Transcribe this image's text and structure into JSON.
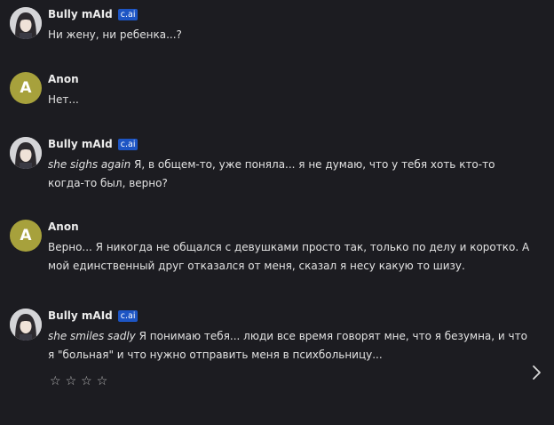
{
  "messages": [
    {
      "author": "Bully mAId",
      "badge": "c.ai",
      "avatar_type": "bot",
      "action": "",
      "text": "Ни жену, ни ребенка...?"
    },
    {
      "author": "Anon",
      "badge": "",
      "avatar_type": "user",
      "avatar_letter": "A",
      "action": "",
      "text": "Нет..."
    },
    {
      "author": "Bully mAId",
      "badge": "c.ai",
      "avatar_type": "bot",
      "action": "she sighs again",
      "text": "Я, в общем-то, уже поняла... я не думаю, что у тебя хоть кто-то когда-то был, верно?"
    },
    {
      "author": "Anon",
      "badge": "",
      "avatar_type": "user",
      "avatar_letter": "A",
      "action": "",
      "text": "Верно... Я никогда не общался с девушками просто так, только по делу и коротко. А мой единственный друг отказался от меня, сказал я несу какую то шизу."
    },
    {
      "author": "Bully mAId",
      "badge": "c.ai",
      "avatar_type": "bot",
      "action": "she smiles sadly",
      "text": "Я понимаю тебя... люди все время говорят мне, что я безумна, и что я \"больная\" и что нужно отправить меня в психбольницу..."
    }
  ],
  "rating": {
    "stars": [
      "☆",
      "☆",
      "☆",
      "☆"
    ],
    "max": 4,
    "value": 0
  },
  "colors": {
    "background": "#1c1c21",
    "badge": "#1d55c4",
    "user_avatar": "#a7a13c"
  },
  "icons": {
    "next": "chevron-right-icon"
  }
}
